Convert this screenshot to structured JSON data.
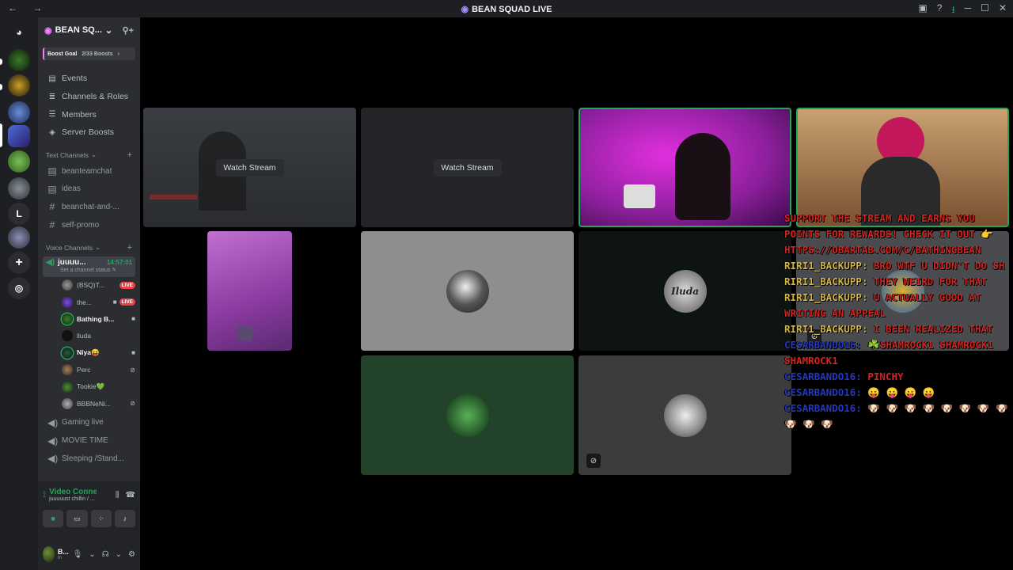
{
  "titlebar": {
    "title": "BEAN SQUAD LIVE",
    "nav": "← →"
  },
  "server": {
    "name": "BEAN SQ...",
    "boost_goal": "Boost Goal",
    "boost_count": "2/33 Boosts",
    "rail_letter": "L"
  },
  "menu": [
    {
      "label": "Events",
      "icon": "calendar-icon"
    },
    {
      "label": "Channels & Roles",
      "icon": "list-icon"
    },
    {
      "label": "Members",
      "icon": "members-icon"
    },
    {
      "label": "Server Boosts",
      "icon": "boost-icon"
    }
  ],
  "text_category": "Text Channels",
  "text_channels": [
    "beanteamchat",
    "ideas",
    "beanchat-and-...",
    "self-promo"
  ],
  "voice_category": "Voice Channels",
  "active_voice": {
    "name": "juuuu...",
    "time": "14:57:01",
    "status": "Set a channel status"
  },
  "voice_users": [
    {
      "name": "(BSQ)T...",
      "live": "LIVE"
    },
    {
      "name": "the...",
      "live": "LIVE"
    },
    {
      "name": "Bathing B..."
    },
    {
      "name": "iluda"
    },
    {
      "name": "Niya😝"
    },
    {
      "name": "Perc"
    },
    {
      "name": "Tookie💚"
    },
    {
      "name": "BBBNeNi..."
    }
  ],
  "other_voice": [
    "Gaming live",
    "MOVIE TIME",
    "Sleeping /Stand..."
  ],
  "voice_panel": {
    "status": "Video Connected",
    "channel": "juuuuust chillin / ..."
  },
  "user": {
    "name": "B...",
    "status": "In"
  },
  "tiles": {
    "watch_label": "Watch Stream",
    "iluda_label": "Iluda"
  },
  "chat": [
    {
      "user": "",
      "text": "SUPPORT THE STREAM AND EARNS YOU POINTS FOR REWARDS! CHECK IT OUT 👉 HTTPS://OBARTAB.COM/C/BATHINGBEAN",
      "utype": "red"
    },
    {
      "user": "RIRI1_BACKUPP:",
      "text": "BRO WTF U DIDN'T DO SH",
      "utype": "gold"
    },
    {
      "user": "RIRI1_BACKUPP:",
      "text": "THEY WEIRD FOR THAT",
      "utype": "gold"
    },
    {
      "user": "RIRI1_BACKUPP:",
      "text": "U ACTUALLY GOOD AT WRITING AN APPEAL",
      "utype": "gold"
    },
    {
      "user": "RIRI1_BACKUPP:",
      "text": "I BEEN REALIZED THAT",
      "utype": "gold"
    },
    {
      "user": "CESARBANDO16:",
      "text": "☘️SHAMROCK1 SHAMROCK1 SHAMROCK1",
      "utype": "blue"
    },
    {
      "user": "CESARBANDO16:",
      "text": "PINCHY",
      "utype": "blue"
    },
    {
      "user": "CESARBANDO16:",
      "text": "😛 😛 😛 😛",
      "utype": "blue"
    },
    {
      "user": "CESARBANDO16:",
      "text": "🐶 🐶 🐶 🐶 🐶 🐶 🐶 🐶 🐶 🐶 🐶",
      "utype": "blue"
    }
  ],
  "colors": {
    "accent_green": "#23a55a",
    "live_red": "#ed4245",
    "chat_red": "#d2241f",
    "chat_gold": "#d6b540",
    "chat_blue": "#2438b8"
  }
}
